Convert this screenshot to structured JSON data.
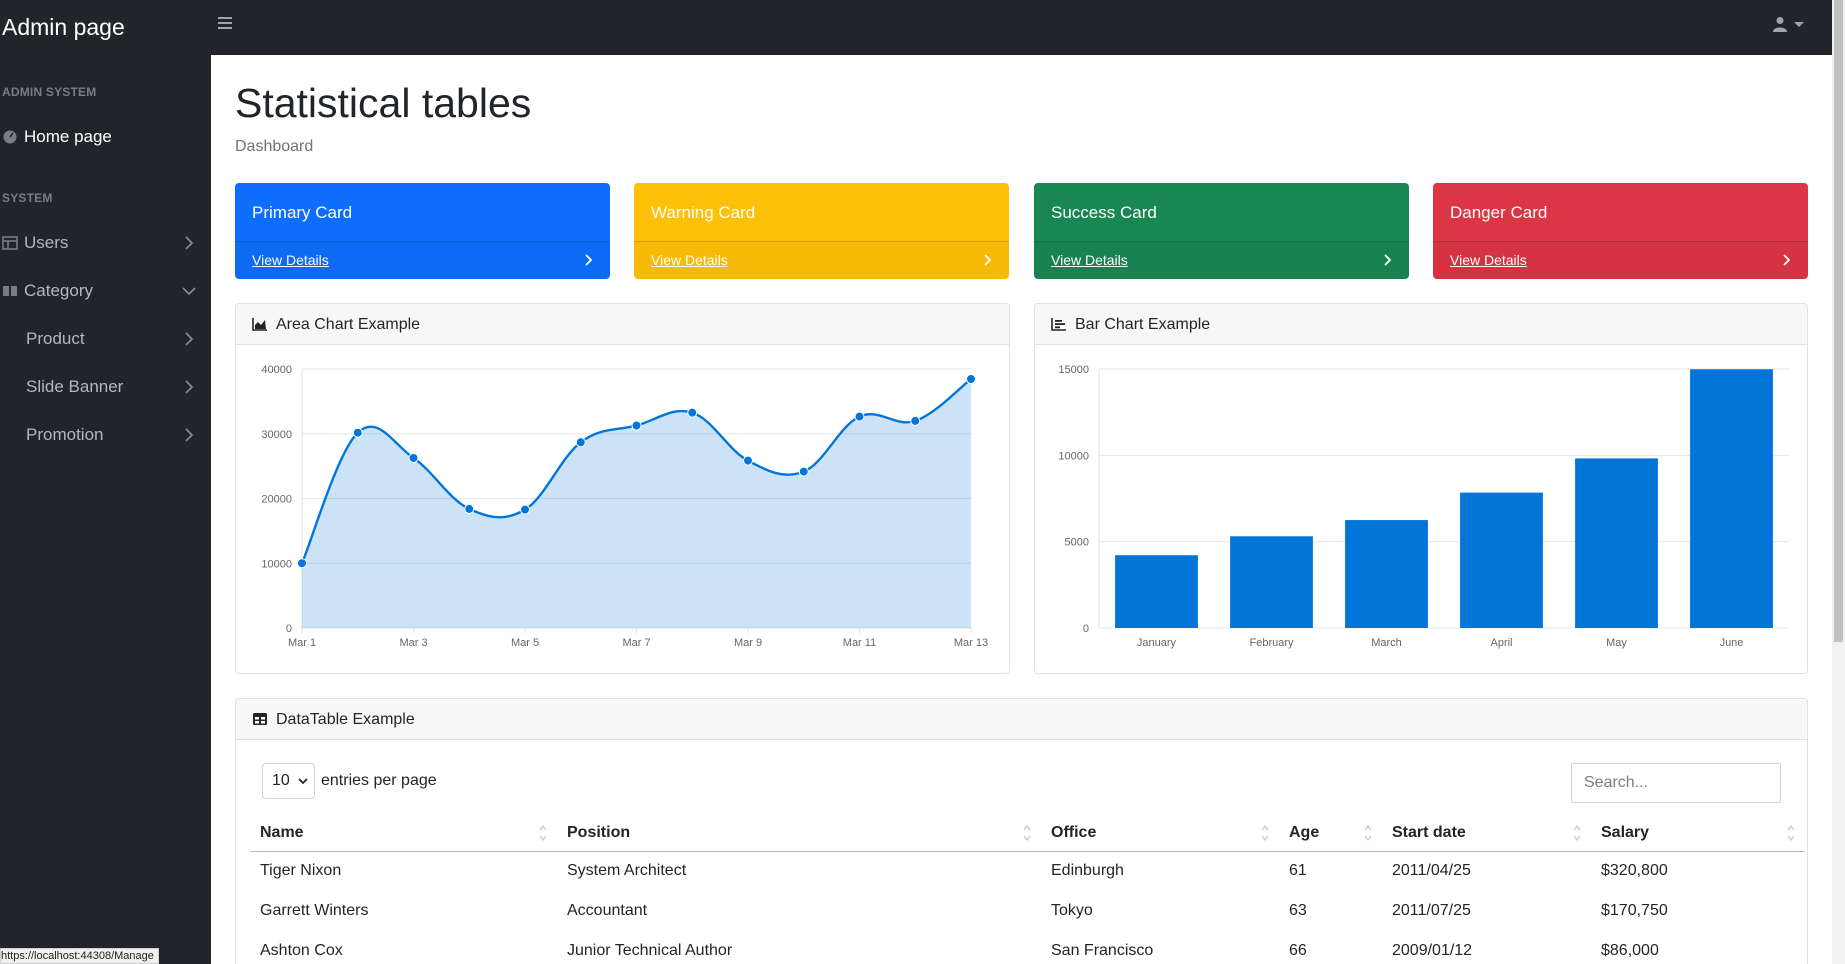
{
  "app": {
    "brand": "Admin page"
  },
  "sidebar": {
    "headings": {
      "admin": "ADMIN SYSTEM",
      "system": "SYSTEM"
    },
    "home": "Home page",
    "users": "Users",
    "category": "Category",
    "product": "Product",
    "slide_banner": "Slide Banner",
    "promotion": "Promotion"
  },
  "status_bar": {
    "url": "https://localhost:44308/Manage"
  },
  "page": {
    "title": "Statistical tables",
    "breadcrumb": "Dashboard"
  },
  "cards": [
    {
      "title": "Primary Card",
      "link": "View Details",
      "color": "#0d6efd"
    },
    {
      "title": "Warning Card",
      "link": "View Details",
      "color": "#ffc107"
    },
    {
      "title": "Success Card",
      "link": "View Details",
      "color": "#198754"
    },
    {
      "title": "Danger Card",
      "link": "View Details",
      "color": "#dc3545"
    }
  ],
  "area_panel": {
    "title": "Area Chart Example"
  },
  "bar_panel": {
    "title": "Bar Chart Example"
  },
  "chart_data": [
    {
      "type": "area",
      "title": "",
      "x": [
        "Mar 1",
        "Mar 2",
        "Mar 3",
        "Mar 4",
        "Mar 5",
        "Mar 6",
        "Mar 7",
        "Mar 8",
        "Mar 9",
        "Mar 10",
        "Mar 11",
        "Mar 12",
        "Mar 13"
      ],
      "x_tick_labels": [
        "Mar 1",
        "Mar 3",
        "Mar 5",
        "Mar 7",
        "Mar 9",
        "Mar 11",
        "Mar 13"
      ],
      "values": [
        10000,
        30162,
        26263,
        18394,
        18287,
        28682,
        31274,
        33259,
        25849,
        24159,
        32651,
        31984,
        38451
      ],
      "ylim": [
        0,
        40000
      ],
      "y_ticks": [
        0,
        10000,
        20000,
        30000,
        40000
      ],
      "color": "#0275d8",
      "fill": "rgba(2,117,216,0.2)",
      "grid": true
    },
    {
      "type": "bar",
      "title": "",
      "categories": [
        "January",
        "February",
        "March",
        "April",
        "May",
        "June"
      ],
      "values": [
        4215,
        5312,
        6251,
        7841,
        9821,
        14984
      ],
      "ylim": [
        0,
        15000
      ],
      "y_ticks": [
        0,
        5000,
        10000,
        15000
      ],
      "color": "#0275d8",
      "grid": true
    }
  ],
  "datatable": {
    "title": "DataTable Example",
    "page_size": "10",
    "entries_label": "entries per page",
    "search_placeholder": "Search...",
    "columns": [
      "Name",
      "Position",
      "Office",
      "Age",
      "Start date",
      "Salary"
    ],
    "rows": [
      [
        "Tiger Nixon",
        "System Architect",
        "Edinburgh",
        "61",
        "2011/04/25",
        "$320,800"
      ],
      [
        "Garrett Winters",
        "Accountant",
        "Tokyo",
        "63",
        "2011/07/25",
        "$170,750"
      ],
      [
        "Ashton Cox",
        "Junior Technical Author",
        "San Francisco",
        "66",
        "2009/01/12",
        "$86,000"
      ]
    ]
  }
}
